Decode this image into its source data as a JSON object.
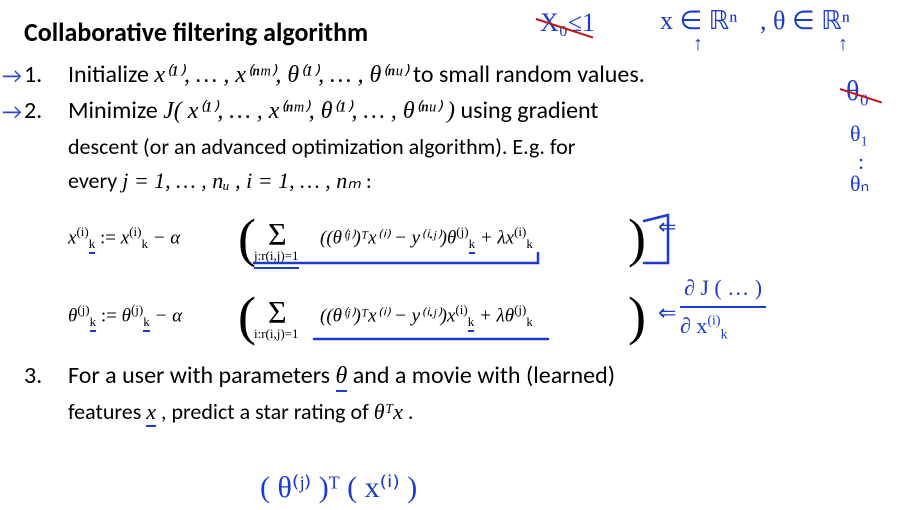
{
  "title": "Collaborative filtering algorithm",
  "steps": {
    "one": {
      "num": "1.",
      "text_a": "Initialize ",
      "math_a": "x⁽¹⁾, … , x⁽ⁿᵐ⁾, θ⁽¹⁾, … , θ⁽ⁿᵘ⁾",
      "text_b": " to small random values."
    },
    "two": {
      "num": "2.",
      "text_a": "Minimize ",
      "math_a": "J( x⁽¹⁾, … , x⁽ⁿᵐ⁾, θ⁽¹⁾, … , θ⁽ⁿᵘ⁾ )",
      "text_b": "  using gradient",
      "line_b": "descent (or an advanced optimization algorithm). E.g. for",
      "line_c_a": "every ",
      "line_c_math": "j = 1, … , nᵤ ,  i = 1, … , nₘ",
      "line_c_b": "  :",
      "update_x_lhs": "x",
      "update_x_rhs": "x",
      "update_x_sigma_head": "Σ",
      "update_x_sigma_sub": "j:r(i,j)=1",
      "update_x_inside": "((θ⁽ʲ⁾)ᵀx⁽ⁱ⁾ − y⁽ⁱ·ʲ⁾)θ",
      "update_x_reg": " + λx",
      "update_t_lhs": "θ",
      "update_t_rhs": "θ",
      "update_t_sigma_head": "Σ",
      "update_t_sigma_sub": "i:r(i,j)=1",
      "update_t_inside": "((θ⁽ʲ⁾)ᵀx⁽ⁱ⁾ − y⁽ⁱ·ʲ⁾)x",
      "update_t_reg": " + λθ",
      "sup_i": "(i)",
      "sup_j": "(j)",
      "sub_k": "k",
      "assign": " :=  ",
      "minus_alpha": " − α ",
      "big_lparen": "(",
      "big_rparen": ")"
    },
    "three": {
      "num": "3.",
      "line_a_a": "For a user with parameters ",
      "line_a_math1": "θ",
      "line_a_b": "  and a movie with (learned)",
      "line_b_a": "features ",
      "line_b_math1": "x",
      "line_b_b": "  , predict a star rating of ",
      "line_b_math2": "θᵀx",
      "line_b_c": "  ."
    }
  },
  "hand": {
    "top_left_strike": "X₀≤1",
    "top_right_1": "x ∈ ℝⁿ",
    "top_right_2": ",  θ ∈ ℝⁿ",
    "up_arrow1": "↑",
    "up_arrow2": "↑",
    "right_theta0_strike": "θ₀",
    "theta_list_1": "θ₁",
    "theta_list_dots": ":",
    "theta_list_n": "θₙ",
    "arrow_in1": "⇐",
    "arrow_in2": "⇐",
    "partial": "∂",
    "partial_frac_top": "  J ( …  )",
    "partial_frac_bot": "∂ x",
    "partial_frac_bot_sup": "(i)",
    "partial_frac_bot_sub": "k",
    "bottom_math": "( θ⁽ʲ⁾ )ᵀ ( x⁽ⁱ⁾ )"
  }
}
